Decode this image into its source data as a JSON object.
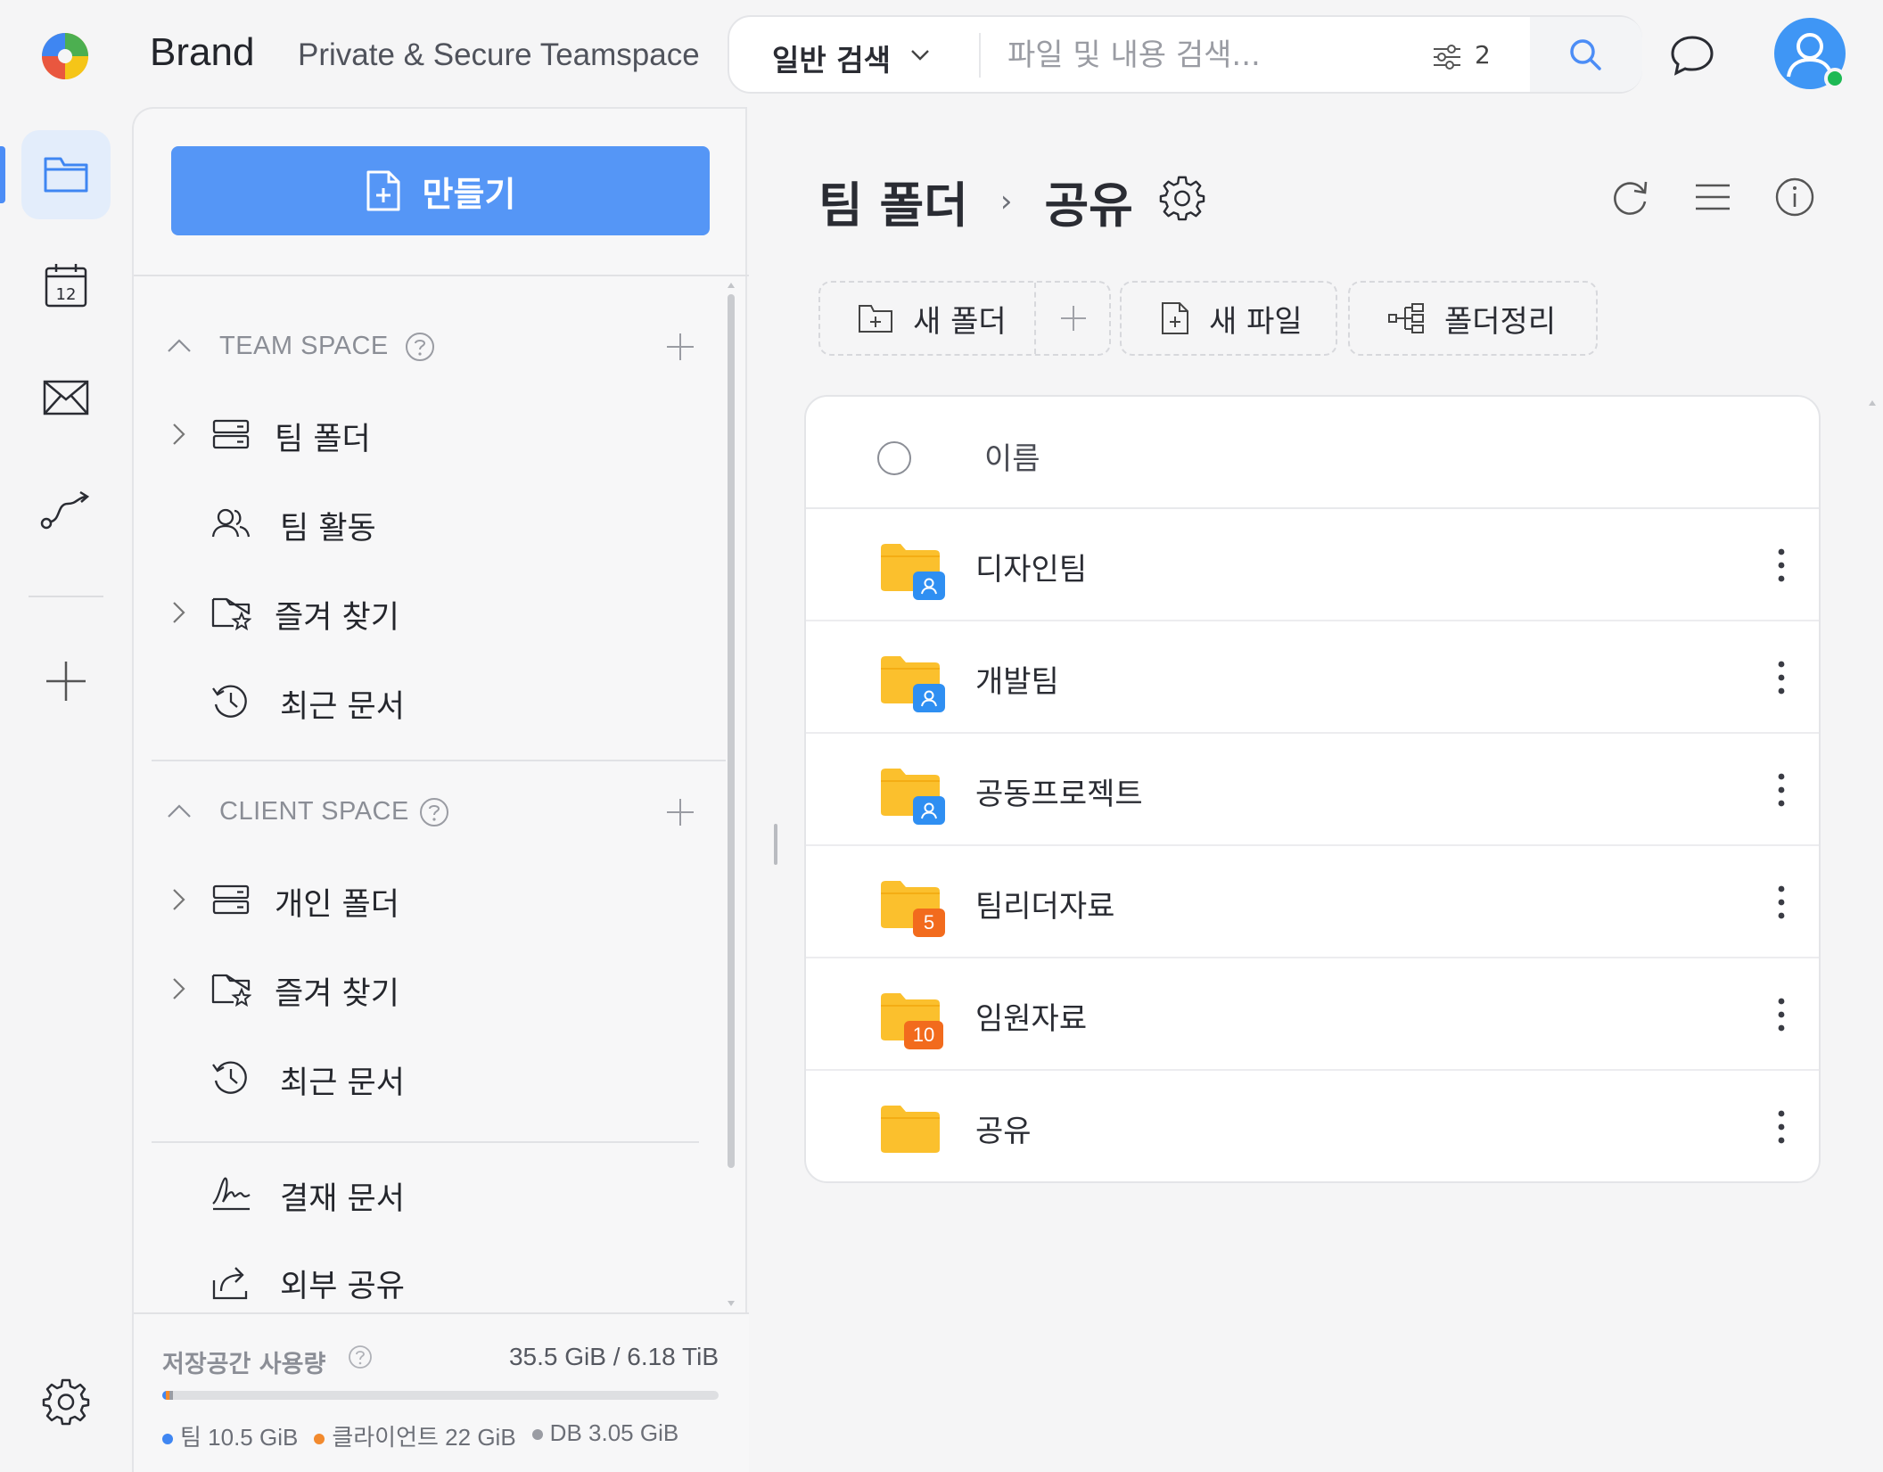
{
  "header": {
    "brand": "Brand",
    "tagline": "Private & Secure Teamspace",
    "search_mode": "일반 검색",
    "search_placeholder": "파일 및 내용 검색...",
    "filter_count": "2"
  },
  "rail": {
    "calendar_day": "12"
  },
  "sidebar": {
    "create_label": "만들기",
    "team_space": {
      "title": "TEAM SPACE",
      "items": [
        {
          "label": "팀 폴더",
          "icon": "server-icon"
        },
        {
          "label": "팀 활동",
          "icon": "people-icon"
        },
        {
          "label": "즐겨 찾기",
          "icon": "folder-star-icon"
        },
        {
          "label": "최근 문서",
          "icon": "history-icon"
        }
      ]
    },
    "client_space": {
      "title": "CLIENT SPACE",
      "items": [
        {
          "label": "개인 폴더",
          "icon": "server-icon"
        },
        {
          "label": "즐겨 찾기",
          "icon": "folder-star-icon"
        },
        {
          "label": "최근 문서",
          "icon": "history-icon"
        }
      ]
    },
    "extra_items": [
      {
        "label": "결재 문서",
        "icon": "signature-icon"
      },
      {
        "label": "외부 공유",
        "icon": "share-icon"
      }
    ],
    "storage": {
      "title": "저장공간 사용량",
      "total": "35.5 GiB / 6.18 TiB",
      "segments": [
        {
          "label": "팀",
          "value": "10.5 GiB",
          "color": "#3f86f2",
          "fraction": 0.0017
        },
        {
          "label": "클라이언트",
          "value": "22 GiB",
          "color": "#f28a2e",
          "fraction": 0.0035
        },
        {
          "label": "DB",
          "value": "3.05 GiB",
          "color": "#9a9ca3",
          "fraction": 0.0005
        }
      ]
    }
  },
  "main": {
    "breadcrumb": [
      "팀 폴더",
      "공유"
    ],
    "actions": {
      "new_folder": "새 폴더",
      "new_file": "새 파일",
      "organize": "폴더정리"
    },
    "table": {
      "header_name": "이름",
      "rows": [
        {
          "name": "디자인팀",
          "badge_type": "user",
          "badge": "",
          "badge_color": "#2f8ff2"
        },
        {
          "name": "개발팀",
          "badge_type": "user",
          "badge": "",
          "badge_color": "#2f8ff2"
        },
        {
          "name": "공동프로젝트",
          "badge_type": "user",
          "badge": "",
          "badge_color": "#2f8ff2"
        },
        {
          "name": "팀리더자료",
          "badge_type": "count",
          "badge": "5",
          "badge_color": "#f26b1d"
        },
        {
          "name": "임원자료",
          "badge_type": "count",
          "badge": "10",
          "badge_color": "#f26b1d"
        },
        {
          "name": "공유",
          "badge_type": "none",
          "badge": "",
          "badge_color": ""
        }
      ]
    }
  },
  "colors": {
    "accent": "#5596f6",
    "folder": "#fbc02d"
  }
}
